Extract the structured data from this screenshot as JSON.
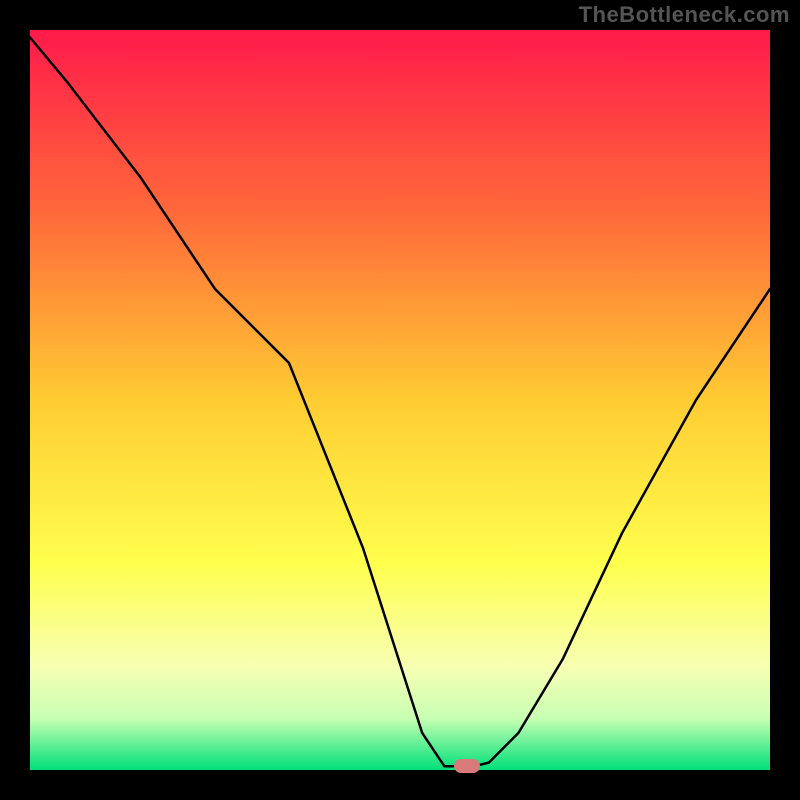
{
  "watermark": "TheBottleneck.com",
  "chart_data": {
    "type": "line",
    "title": "",
    "xlabel": "",
    "ylabel": "",
    "xlim": [
      0,
      100
    ],
    "ylim": [
      0,
      100
    ],
    "grid": false,
    "legend": false,
    "x": [
      0,
      5,
      15,
      25,
      35,
      45,
      53,
      56,
      60,
      62,
      66,
      72,
      80,
      90,
      100
    ],
    "values": [
      99,
      93,
      80,
      65,
      55,
      30,
      5,
      0.5,
      0.5,
      1,
      5,
      15,
      32,
      50,
      65
    ],
    "marker": {
      "x": 59,
      "y": 0.5
    },
    "background_type": "vertical-rainbow-gradient",
    "background_stops": [
      {
        "pos": 0.0,
        "color": "#ff1a4b"
      },
      {
        "pos": 0.25,
        "color": "#ff6a3a"
      },
      {
        "pos": 0.5,
        "color": "#ffcc33"
      },
      {
        "pos": 0.72,
        "color": "#ffff4d"
      },
      {
        "pos": 0.86,
        "color": "#f7ffb3"
      },
      {
        "pos": 0.93,
        "color": "#c8ffb3"
      },
      {
        "pos": 1.0,
        "color": "#00e07a"
      }
    ]
  }
}
